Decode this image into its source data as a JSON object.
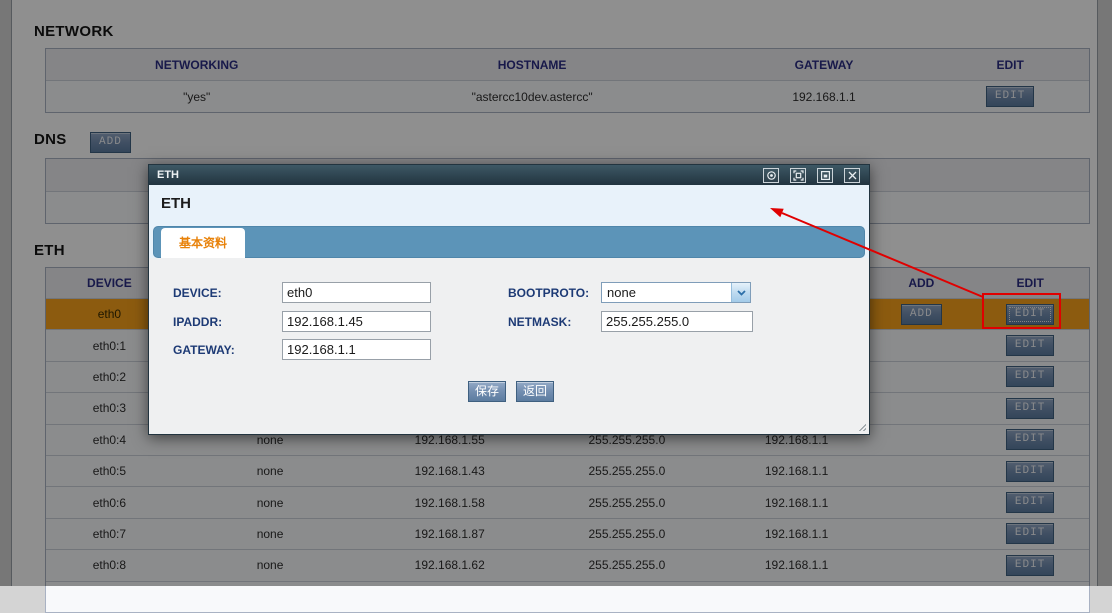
{
  "network": {
    "title": "NETWORK",
    "headers": [
      "NETWORKING",
      "HOSTNAME",
      "GATEWAY",
      "EDIT"
    ],
    "row": {
      "networking": "\"yes\"",
      "hostname": "\"astercc10dev.astercc\"",
      "gateway": "192.168.1.1"
    },
    "edit_label": "EDIT"
  },
  "dns": {
    "title": "DNS",
    "add_label": "ADD"
  },
  "eth": {
    "title": "ETH",
    "headers": [
      "DEVICE",
      "",
      "",
      "",
      "",
      "ADD",
      "EDIT"
    ],
    "add_label": "ADD",
    "edit_label": "EDIT",
    "rows": [
      {
        "device": "eth0",
        "bootproto": "",
        "ipaddr": "",
        "netmask": "",
        "gateway": ""
      },
      {
        "device": "eth0:1",
        "bootproto": "",
        "ipaddr": "",
        "netmask": "",
        "gateway": ""
      },
      {
        "device": "eth0:2",
        "bootproto": "",
        "ipaddr": "",
        "netmask": "",
        "gateway": ""
      },
      {
        "device": "eth0:3",
        "bootproto": "",
        "ipaddr": "",
        "netmask": "",
        "gateway": ""
      },
      {
        "device": "eth0:4",
        "bootproto": "none",
        "ipaddr": "192.168.1.55",
        "netmask": "255.255.255.0",
        "gateway": "192.168.1.1"
      },
      {
        "device": "eth0:5",
        "bootproto": "none",
        "ipaddr": "192.168.1.43",
        "netmask": "255.255.255.0",
        "gateway": "192.168.1.1"
      },
      {
        "device": "eth0:6",
        "bootproto": "none",
        "ipaddr": "192.168.1.58",
        "netmask": "255.255.255.0",
        "gateway": "192.168.1.1"
      },
      {
        "device": "eth0:7",
        "bootproto": "none",
        "ipaddr": "192.168.1.87",
        "netmask": "255.255.255.0",
        "gateway": "192.168.1.1"
      },
      {
        "device": "eth0:8",
        "bootproto": "none",
        "ipaddr": "192.168.1.62",
        "netmask": "255.255.255.0",
        "gateway": "192.168.1.1"
      }
    ]
  },
  "dialog": {
    "title": "ETH",
    "heading": "ETH",
    "tab_label": "基本资料",
    "window_icons": [
      "collapse-icon",
      "maximize-icon",
      "restore-icon",
      "close-icon"
    ],
    "fields": {
      "device": {
        "label": "DEVICE:",
        "value": "eth0"
      },
      "ipaddr": {
        "label": "IPADDR:",
        "value": "192.168.1.45"
      },
      "gateway": {
        "label": "GATEWAY:",
        "value": "192.168.1.1"
      },
      "bootproto": {
        "label": "BOOTPROTO:",
        "value": "none"
      },
      "netmask": {
        "label": "NETMASK:",
        "value": "255.255.255.0"
      }
    },
    "save_label": "保存",
    "back_label": "返回"
  },
  "annotation": {
    "highlight_color": "#e00000"
  }
}
